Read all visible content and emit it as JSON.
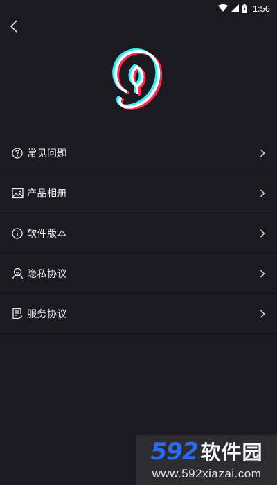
{
  "status_bar": {
    "time": "1:56",
    "icons": [
      "wifi-icon",
      "signal-icon",
      "battery-icon"
    ]
  },
  "header": {
    "back_icon": "chevron-left-icon",
    "logo_icon": "app-logo-icon"
  },
  "menu": {
    "items": [
      {
        "label": "常见问题",
        "icon": "question-circle-icon"
      },
      {
        "label": "产品相册",
        "icon": "image-icon"
      },
      {
        "label": "软件版本",
        "icon": "info-circle-icon"
      },
      {
        "label": "隐私协议",
        "icon": "user-icon"
      },
      {
        "label": "服务协议",
        "icon": "document-icon"
      }
    ]
  },
  "watermark": {
    "number": "592",
    "text": "软件园",
    "url": "www.592xiazai.com"
  },
  "colors": {
    "background": "#1b1a20",
    "divider": "#0f0e12",
    "watermark_blue": "#2a6cf0",
    "logo_red": "#ff2e55",
    "logo_cyan": "#2ef0f0"
  }
}
